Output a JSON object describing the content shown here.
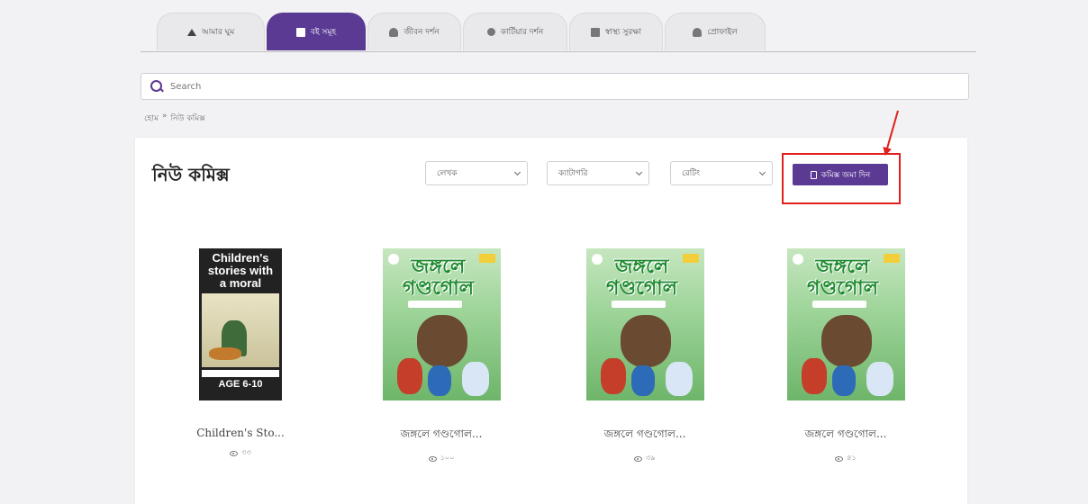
{
  "tabs": [
    {
      "label": "আমার ঘুম",
      "icon": "home-icon"
    },
    {
      "label": "বই সমূহ",
      "icon": "book-icon",
      "active": true
    },
    {
      "label": "জীবন দর্শন",
      "icon": "person-icon"
    },
    {
      "label": "কার্টিয়ার দর্শন",
      "icon": "person-icon"
    },
    {
      "label": "স্বাস্থ্য সুরক্ষা",
      "icon": "document-icon"
    },
    {
      "label": "প্রোফাইল",
      "icon": "profile-icon"
    }
  ],
  "search": {
    "placeholder": "Search"
  },
  "breadcrumb": {
    "home": "হোম",
    "separator": "»",
    "current": "নিউ কমিক্স"
  },
  "page": {
    "title": "নিউ কমিক্স"
  },
  "filters": {
    "author": "লেখক",
    "category": "ক্যাটাগরি",
    "rating": "রেটিং"
  },
  "add_button": {
    "label": "কমিক্স জমা দিন"
  },
  "books": [
    {
      "title": "Children's Sto...",
      "views": "৩৩",
      "cover": {
        "line1": "Children's",
        "line2": "stories with",
        "line3": "a moral",
        "age": "AGE 6-10"
      }
    },
    {
      "title": "জঙ্গলে গণ্ডগোল...",
      "views": "১০০",
      "cover": {
        "title": "জঙ্গলে গণ্ডগোল"
      }
    },
    {
      "title": "জঙ্গলে গণ্ডগোল...",
      "views": "৩৯",
      "cover": {
        "title": "জঙ্গলে গণ্ডগোল"
      }
    },
    {
      "title": "জঙ্গলে গণ্ডগোল...",
      "views": "৪১",
      "cover": {
        "title": "জঙ্গলে গণ্ডগোল"
      }
    }
  ],
  "colors": {
    "accent": "#5b3a94",
    "highlight": "#e0201c"
  }
}
